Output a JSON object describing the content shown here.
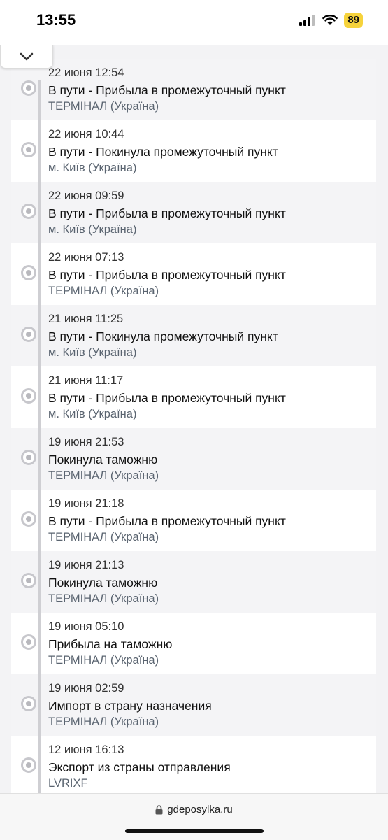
{
  "status_bar": {
    "time": "13:55",
    "battery": "89"
  },
  "events": [
    {
      "date": "22 июня 12:54",
      "status": "В пути - Прибыла в промежуточный пункт",
      "location": "ТЕРМІНАЛ (Україна)"
    },
    {
      "date": "22 июня 10:44",
      "status": "В пути - Покинула промежуточный пункт",
      "location": "м. Київ (Україна)"
    },
    {
      "date": "22 июня 09:59",
      "status": "В пути - Прибыла в промежуточный пункт",
      "location": "м. Київ (Україна)"
    },
    {
      "date": "22 июня 07:13",
      "status": "В пути - Прибыла в промежуточный пункт",
      "location": "ТЕРМІНАЛ (Україна)"
    },
    {
      "date": "21 июня 11:25",
      "status": "В пути - Покинула промежуточный пункт",
      "location": "м. Київ (Україна)"
    },
    {
      "date": "21 июня 11:17",
      "status": "В пути - Прибыла в промежуточный пункт",
      "location": "м. Київ (Україна)"
    },
    {
      "date": "19 июня 21:53",
      "status": "Покинула таможню",
      "location": "ТЕРМІНАЛ (Україна)"
    },
    {
      "date": "19 июня 21:18",
      "status": "В пути - Прибыла в промежуточный пункт",
      "location": "ТЕРМІНАЛ (Україна)"
    },
    {
      "date": "19 июня 21:13",
      "status": "Покинула таможню",
      "location": "ТЕРМІНАЛ (Україна)"
    },
    {
      "date": "19 июня 05:10",
      "status": "Прибыла на таможню",
      "location": "ТЕРМІНАЛ (Україна)"
    },
    {
      "date": "19 июня 02:59",
      "status": "Импорт в страну назначения",
      "location": "ТЕРМІНАЛ (Україна)"
    },
    {
      "date": "12 июня 16:13",
      "status": "Экспорт из страны отправления",
      "location": "LVRIXF"
    }
  ],
  "browser": {
    "url": "gdeposylka.ru"
  },
  "icons": {
    "collapse": "chevron-down-icon",
    "lock": "lock-icon",
    "signal": "cellular-signal-icon",
    "wifi": "wifi-icon"
  }
}
